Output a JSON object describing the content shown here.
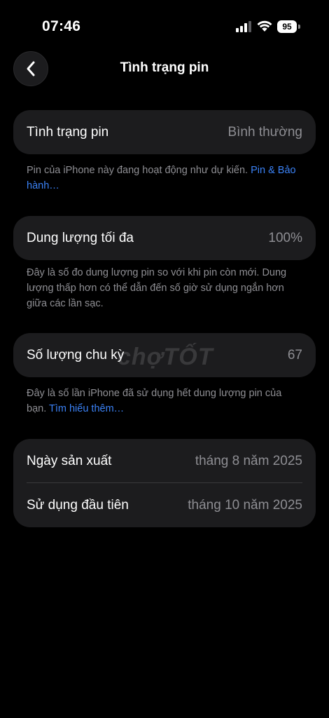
{
  "status_bar": {
    "time": "07:46",
    "battery_level": "95",
    "signal_icon": "cellular-signal-icon",
    "wifi_icon": "wifi-icon"
  },
  "header": {
    "title": "Tình trạng pin",
    "back_icon": "chevron-left-icon"
  },
  "battery_health": {
    "label": "Tình trạng pin",
    "value": "Bình thường",
    "footnote_text": "Pin của iPhone này đang hoạt động như dự kiến. ",
    "footnote_link": "Pin & Bảo hành…"
  },
  "max_capacity": {
    "label": "Dung lượng tối đa",
    "value": "100%",
    "footnote": "Đây là số đo dung lượng pin so với khi pin còn mới. Dung lượng thấp hơn có thể dẫn đến số giờ sử dụng ngắn hơn giữa các lần sạc."
  },
  "cycle_count": {
    "label": "Số lượng chu kỳ",
    "value": "67",
    "footnote_text": "Đây là số lần iPhone đã sử dụng hết dung lượng pin của bạn. ",
    "footnote_link": "Tìm hiểu thêm…"
  },
  "dates": {
    "manufacture_label": "Ngày sản xuất",
    "manufacture_value": "tháng 8 năm 2025",
    "first_use_label": "Sử dụng đầu tiên",
    "first_use_value": "tháng 10 năm 2025"
  },
  "watermark": "chợTỐT",
  "colors": {
    "background": "#000000",
    "card": "#1c1c1e",
    "secondary_text": "#8e8e93",
    "link": "#3b82f6"
  }
}
